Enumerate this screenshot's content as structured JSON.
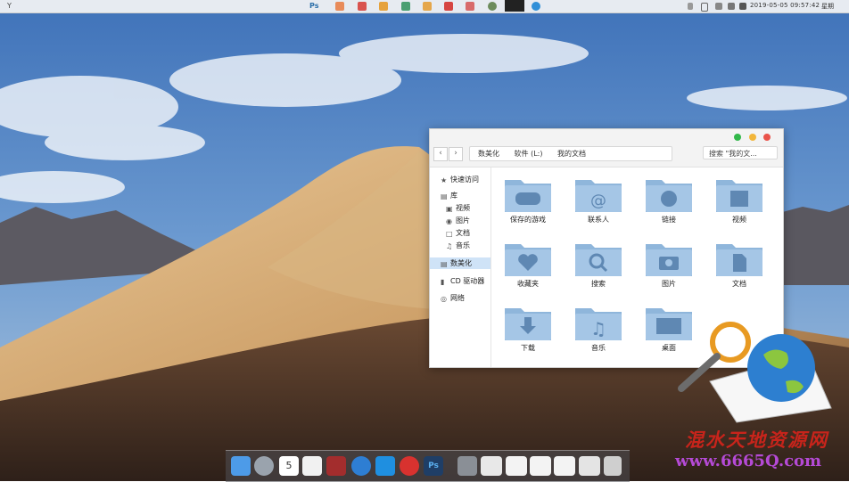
{
  "menubar": {
    "left_icons": [
      "spider-icon",
      "photoshop-icon",
      "app-icon",
      "app-icon",
      "app-icon",
      "app-icon",
      "app-icon",
      "app-icon",
      "netease-icon",
      "screen-icon",
      "app-icon"
    ],
    "photoshop_label": "Ps",
    "datetime": "2019-05-05  09:57:42",
    "weekday": "星期"
  },
  "finder": {
    "path": [
      "数美化",
      "软件 (L:)",
      "我的文档"
    ],
    "search_placeholder": "搜索 \"我的文...",
    "sidebar": [
      {
        "label": "快速访问",
        "icon": "star-icon"
      },
      {
        "label": "库",
        "icon": "library-icon"
      },
      {
        "label": "视频",
        "icon": "video-icon"
      },
      {
        "label": "图片",
        "icon": "camera-icon"
      },
      {
        "label": "文档",
        "icon": "document-icon"
      },
      {
        "label": "音乐",
        "icon": "music-icon"
      },
      {
        "label": "数美化",
        "icon": "drive-icon"
      },
      {
        "label": "CD 驱动器",
        "icon": "cd-drive-icon"
      },
      {
        "label": "网络",
        "icon": "network-icon"
      }
    ],
    "folders": [
      {
        "label": "保存的游戏",
        "icon": "gamepad-icon"
      },
      {
        "label": "联系人",
        "icon": "at-sign-icon"
      },
      {
        "label": "链接",
        "icon": "globe-icon"
      },
      {
        "label": "视频",
        "icon": "film-icon"
      },
      {
        "label": "收藏夹",
        "icon": "heart-icon"
      },
      {
        "label": "搜索",
        "icon": "magnifier-icon"
      },
      {
        "label": "图片",
        "icon": "camera-icon"
      },
      {
        "label": "文档",
        "icon": "document-icon"
      },
      {
        "label": "下载",
        "icon": "download-icon"
      },
      {
        "label": "音乐",
        "icon": "music-note-icon"
      },
      {
        "label": "桌面",
        "icon": "desktop-icon"
      }
    ],
    "selected_sidebar_index": 6
  },
  "dock": {
    "calendar_day": "5",
    "ps_label": "Ps",
    "items": [
      "finder-icon",
      "launchpad-icon",
      "calendar-icon",
      "notes-icon",
      "photo-booth-icon",
      "safari-icon",
      "app-store-icon",
      "netease-music-icon",
      "photoshop-icon",
      "automator-icon",
      "window-icon",
      "window-icon",
      "window-icon",
      "window-icon",
      "calculator-icon",
      "trash-icon"
    ]
  },
  "watermark": {
    "cn": "混水天地资源网",
    "url": "www.6665Q.com"
  },
  "colors": {
    "folder_blue": "#8fb6db",
    "folder_glyph": "#5f88b3",
    "selection": "#cfe3f7",
    "close": "#e9534a",
    "minimize": "#f2b63a",
    "zoom": "#32b84a"
  }
}
